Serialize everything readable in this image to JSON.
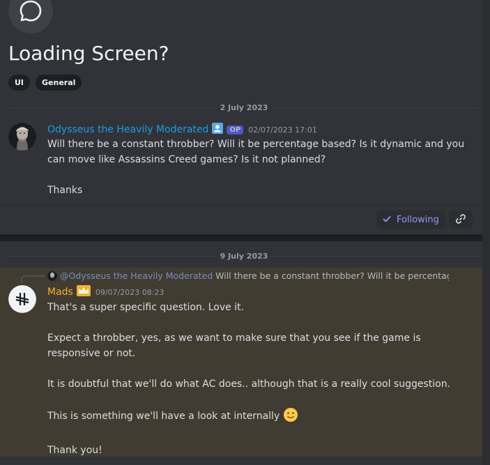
{
  "thread": {
    "icon": "chat-bubble-icon",
    "title": "Loading Screen?",
    "tags": [
      "UI",
      "General"
    ]
  },
  "messages": [
    {
      "date_divider": "2 July 2023",
      "author": "Odysseus the Heavily Moderated",
      "author_color": "#1e9be5",
      "badge_icon": "user-badge-icon",
      "op_badge": "OP",
      "timestamp": "02/07/2023 17:01",
      "body": "Will there be a constant throbber? Will it be percentage based? Is it dynamic and you\ncan move like Assassins Creed games? Is it not planned?\n\nThanks"
    },
    {
      "date_divider": "9 July 2023",
      "reply_mention": "@Odysseus the Heavily Moderated",
      "reply_preview": "Will there be a constant throbber? Will it be percentage ba",
      "author": "Mads",
      "author_color": "#f0b232",
      "badge_icon": "crown-icon",
      "timestamp": "09/07/2023 08:23",
      "body": "That's a super specific question. Love it.\n\nExpect a throbber, yes, as we want to make sure that you see if the game is\nresponsive or not.\n\nIt is doubtful that we'll do what AC does.. although that is a really cool suggestion.\n\nThis is something we'll have a look at internally",
      "emoji": "slightly-smiling-face-icon",
      "body_end": "Thank you!"
    }
  ],
  "actions": {
    "following_label": "Following",
    "following_icon": "checkmark-icon",
    "link_icon": "link-icon"
  }
}
